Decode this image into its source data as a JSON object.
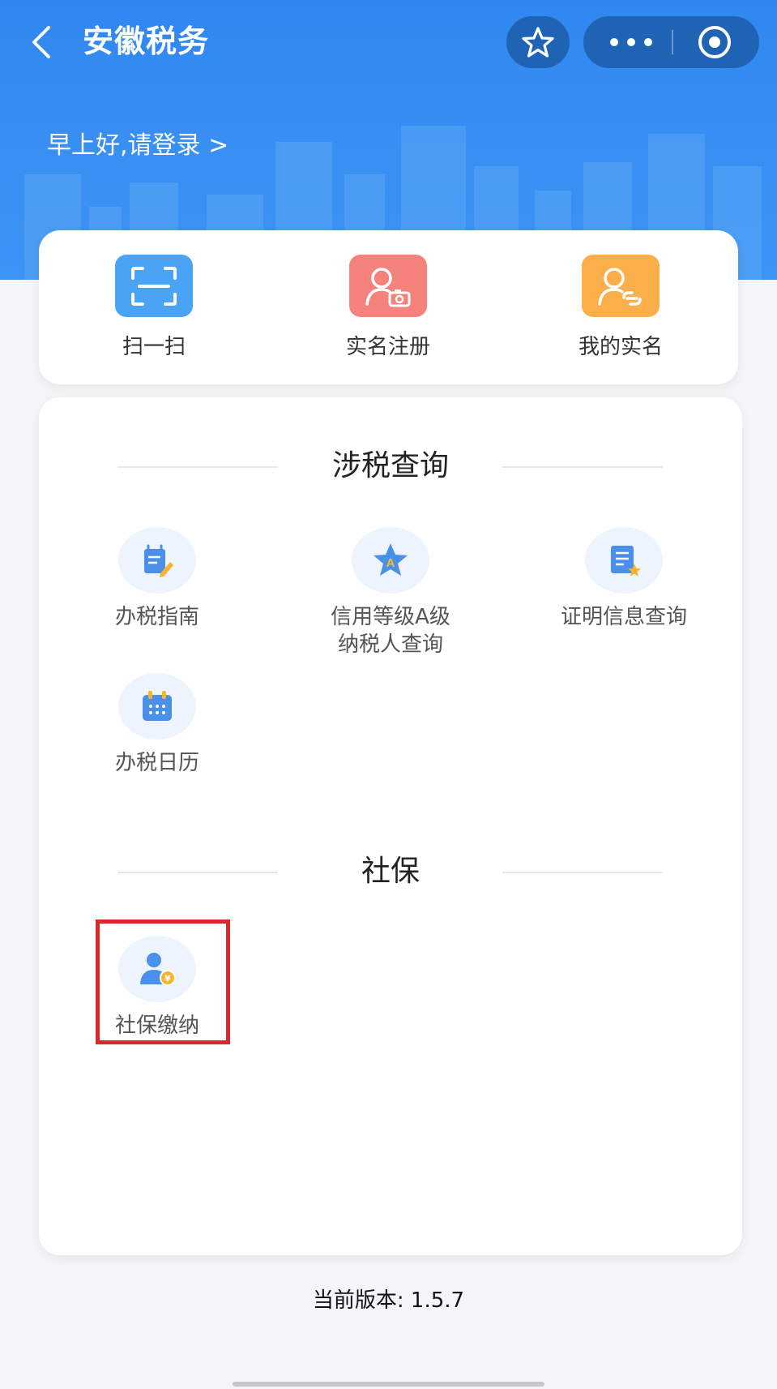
{
  "app": {
    "title": "安徽税务",
    "greeting": "早上好,请登录 >"
  },
  "quick_actions": [
    {
      "label": "扫一扫",
      "icon": "scan-icon",
      "color": "#4aa3f5"
    },
    {
      "label": "实名注册",
      "icon": "user-camera-icon",
      "color": "#f6837b"
    },
    {
      "label": "我的实名",
      "icon": "user-link-icon",
      "color": "#fbae4a"
    }
  ],
  "sections": [
    {
      "title": "涉税查询",
      "items": [
        {
          "label": "办税指南",
          "icon": "guide-edit-icon"
        },
        {
          "label": "信用等级A级\n纳税人查询",
          "icon": "star-a-icon"
        },
        {
          "label": "证明信息查询",
          "icon": "document-star-icon"
        },
        {
          "label": "办税日历",
          "icon": "calendar-icon"
        }
      ]
    },
    {
      "title": "社保",
      "items": [
        {
          "label": "社保缴纳",
          "icon": "user-yen-icon"
        }
      ]
    }
  ],
  "footer": {
    "version": "当前版本: 1.5.7"
  },
  "colors": {
    "header_blue": "#2f87f0",
    "capsule_bg": "#1f63b5",
    "highlight_red": "#d9292f",
    "icon_blue": "#4a90e8"
  }
}
